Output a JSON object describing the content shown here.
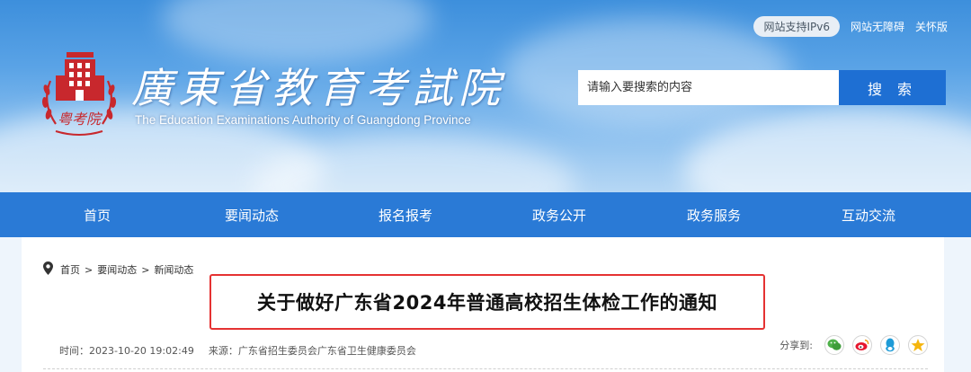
{
  "header": {
    "ipv6_label": "网站支持IPv6",
    "accessibility_link": "网站无障碍",
    "care_mode_link": "关怀版",
    "site_title": "廣東省教育考試院",
    "site_subtitle": "The Education Examinations Authority of Guangdong Province",
    "logo_text": "粤考院",
    "search": {
      "placeholder": "请输入要搜索的内容",
      "button_label": "搜 索"
    }
  },
  "nav": {
    "items": [
      {
        "label": "首页"
      },
      {
        "label": "要闻动态"
      },
      {
        "label": "报名报考"
      },
      {
        "label": "政务公开"
      },
      {
        "label": "政务服务"
      },
      {
        "label": "互动交流"
      }
    ]
  },
  "breadcrumb": {
    "home": "首页",
    "level1": "要闻动态",
    "level2": "新闻动态",
    "separator": ">"
  },
  "article": {
    "title": "关于做好广东省2024年普通高校招生体检工作的通知",
    "time_text": "时间：2023-10-20 19:02:49",
    "source_text": "来源：广东省招生委员会广东省卫生健康委员会"
  },
  "share": {
    "label": "分享到:",
    "icons": [
      "wechat-icon",
      "weibo-icon",
      "qq-icon",
      "qzone-icon"
    ]
  },
  "colors": {
    "nav_bg": "#2a7ad6",
    "search_button": "#1e6fd3",
    "highlight_border": "#e53232",
    "logo_red": "#c8282d"
  }
}
